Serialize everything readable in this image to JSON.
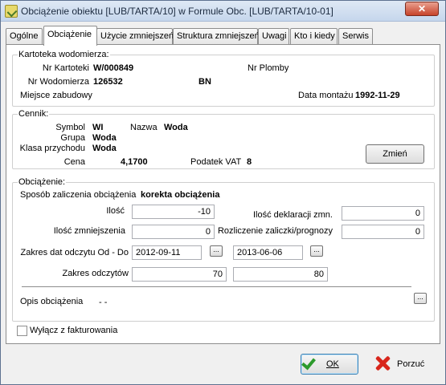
{
  "window": {
    "title": "Obciążenie obiektu [LUB/TARTA/10] w Formule Obc. [LUB/TARTA/10-01]",
    "close_glyph": "✕"
  },
  "tabs": [
    "Ogólne",
    "Obciążenie",
    "Użycie zmniejszeń",
    "Struktura zmniejszeń",
    "Uwagi",
    "Kto i kiedy",
    "Serwis"
  ],
  "kartoteka": {
    "legend": "Kartoteka wodomierza:",
    "nr_kartoteki_label": "Nr Kartoteki",
    "nr_kartoteki": "W/000849",
    "nr_plomby_label": "Nr Plomby",
    "nr_wodomierza_label": "Nr Wodomierza",
    "nr_wodomierza": "126532",
    "nr_wodomierza_suffix": "BN",
    "miejsce_label": "Miejsce zabudowy",
    "data_montazu_label": "Data montażu",
    "data_montazu": "1992-11-29"
  },
  "cennik": {
    "legend": "Cennik:",
    "symbol_label": "Symbol",
    "symbol": "WI",
    "nazwa_label": "Nazwa",
    "nazwa": "Woda",
    "grupa_label": "Grupa",
    "grupa": "Woda",
    "klasa_label": "Klasa przychodu",
    "klasa": "Woda",
    "cena_label": "Cena",
    "cena": "4,1700",
    "vat_label": "Podatek VAT",
    "vat": "8",
    "zmien_label": "Zmień"
  },
  "obciazenie": {
    "legend": "Obciążenie:",
    "sposob_label": "Sposób zaliczenia obciążenia",
    "sposob": "korekta obciążenia",
    "ilosc_label": "Ilość",
    "ilosc": "-10",
    "ilosc_deklaracji_label": "Ilość deklaracji zmn.",
    "ilosc_deklaracji": "0",
    "ilosc_zmn_label": "Ilość zmniejszenia",
    "ilosc_zmn": "0",
    "rozliczenie_label": "Rozliczenie zaliczki/prognozy",
    "rozliczenie": "0",
    "zakres_dat_label": "Zakres dat odczytu Od - Do",
    "data_od": "2012-09-11",
    "data_do": "2013-06-06",
    "zakres_odczytow_label": "Zakres odczytów",
    "odczyt_od": "70",
    "odczyt_do": "80",
    "opis_label": "Opis obciążenia",
    "opis": "- -",
    "dots": "..."
  },
  "wylacz_label": "Wyłącz z fakturowania",
  "buttons": {
    "ok": "OK",
    "porzuc": "Porzuć"
  }
}
